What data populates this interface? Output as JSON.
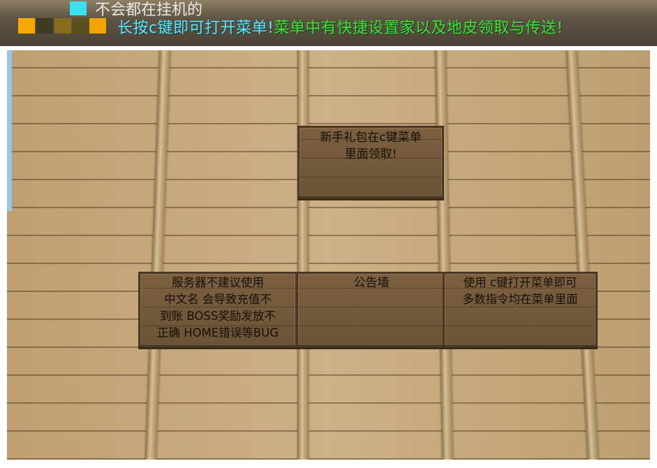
{
  "hud": {
    "top_partial_text": "不会都在挂机的",
    "broadcast": {
      "part1": "长按c键即可打开菜单!",
      "part2": "菜单中有快捷设置家以及地皮领取与传送!"
    }
  },
  "signs": {
    "newbie": {
      "lines": [
        "新手礼包在c键菜单",
        "里面领取!"
      ]
    },
    "server": {
      "lines": [
        "服务器不建议使用",
        "中文名 会导致充值不",
        "到账 BOSS奖励发放不",
        "正确 HOME错误等BUG"
      ]
    },
    "notice": {
      "lines": [
        "公告墙"
      ]
    },
    "menu": {
      "lines": [
        "使用 c键打开菜单即可",
        "多数指令均在菜单里面"
      ]
    }
  },
  "colors": {
    "broadcast_cyan": "#5fe6ff",
    "broadcast_green": "#3fe03a",
    "sign_wood": "#6b5337",
    "wall_wood": "#c2a57a"
  }
}
